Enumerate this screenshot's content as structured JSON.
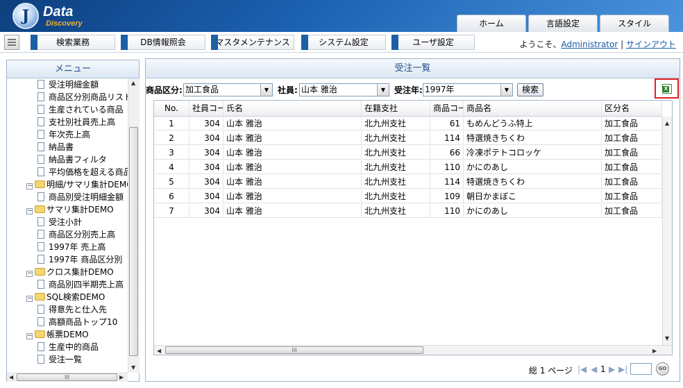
{
  "app": {
    "logo_letter": "J",
    "title": "Data",
    "subtitle": "Discovery"
  },
  "top_tabs": [
    "ホーム",
    "言語設定",
    "スタイル"
  ],
  "nav": [
    "検索業務",
    "DB情報照会",
    "マスタメンテナンス",
    "システム設定",
    "ユーザ設定"
  ],
  "welcome": {
    "prefix": "ようこそ、",
    "user": "Administrator",
    "sep": "|",
    "logout": "サインアウト"
  },
  "sidebar": {
    "title": "メニュー",
    "items": [
      {
        "label": "受注明細金額",
        "type": "doc"
      },
      {
        "label": "商品区分別商品リスト",
        "type": "doc"
      },
      {
        "label": "生産されている商品",
        "type": "doc"
      },
      {
        "label": "支社別社員売上高",
        "type": "doc"
      },
      {
        "label": "年次売上高",
        "type": "doc"
      },
      {
        "label": "納品書",
        "type": "doc"
      },
      {
        "label": "納品書フィルタ",
        "type": "doc"
      },
      {
        "label": "平均価格を超える商品",
        "type": "doc"
      },
      {
        "label": "明細/サマリ集計DEMO",
        "type": "folder"
      },
      {
        "label": "商品別受注明細金額",
        "type": "doc"
      },
      {
        "label": "サマリ集計DEMO",
        "type": "folder"
      },
      {
        "label": "受注小計",
        "type": "doc"
      },
      {
        "label": "商品区分別売上高",
        "type": "doc"
      },
      {
        "label": "1997年 売上高",
        "type": "doc"
      },
      {
        "label": "1997年 商品区分別",
        "type": "doc"
      },
      {
        "label": "クロス集計DEMO",
        "type": "folder"
      },
      {
        "label": "商品別四半期売上高",
        "type": "doc"
      },
      {
        "label": "SQL検索DEMO",
        "type": "folder"
      },
      {
        "label": "得意先と仕入先",
        "type": "doc"
      },
      {
        "label": "高額商品トップ10",
        "type": "doc"
      },
      {
        "label": "帳票DEMO",
        "type": "folder"
      },
      {
        "label": "生産中的商品",
        "type": "doc"
      },
      {
        "label": "受注一覧",
        "type": "doc"
      }
    ]
  },
  "main": {
    "title": "受注一覧",
    "filters": {
      "category_label": "商品区分:",
      "category_value": "加工食品",
      "employee_label": "社員:",
      "employee_value": "山本 雅治",
      "year_label": "受注年:",
      "year_value": "1997年",
      "search_button": "検索"
    },
    "columns": [
      "No.",
      "社員コー",
      "氏名",
      "在籍支社",
      "商品コー",
      "商品名",
      "区分名"
    ],
    "rows": [
      [
        "1",
        "304",
        "山本 雅治",
        "北九州支社",
        "61",
        "もめんどうふ特上",
        "加工食品"
      ],
      [
        "2",
        "304",
        "山本 雅治",
        "北九州支社",
        "114",
        "特選焼きちくわ",
        "加工食品"
      ],
      [
        "3",
        "304",
        "山本 雅治",
        "北九州支社",
        "66",
        "冷凍ポテトコロッケ",
        "加工食品"
      ],
      [
        "4",
        "304",
        "山本 雅治",
        "北九州支社",
        "110",
        "かにのあし",
        "加工食品"
      ],
      [
        "5",
        "304",
        "山本 雅治",
        "北九州支社",
        "114",
        "特選焼きちくわ",
        "加工食品"
      ],
      [
        "6",
        "304",
        "山本 雅治",
        "北九州支社",
        "109",
        "朝日かまぼこ",
        "加工食品"
      ],
      [
        "7",
        "304",
        "山本 雅治",
        "北九州支社",
        "110",
        "かにのあし",
        "加工食品"
      ]
    ],
    "pager": {
      "total": "総 1 ページ",
      "current": "1",
      "go": "GO"
    }
  },
  "icons": {
    "excel": "excel-export-icon",
    "folder": "folder-icon",
    "document": "document-icon"
  },
  "colors": {
    "header_blue": "#1c62b3",
    "accent": "#1c5fa6",
    "highlight_border": "#e02020"
  }
}
